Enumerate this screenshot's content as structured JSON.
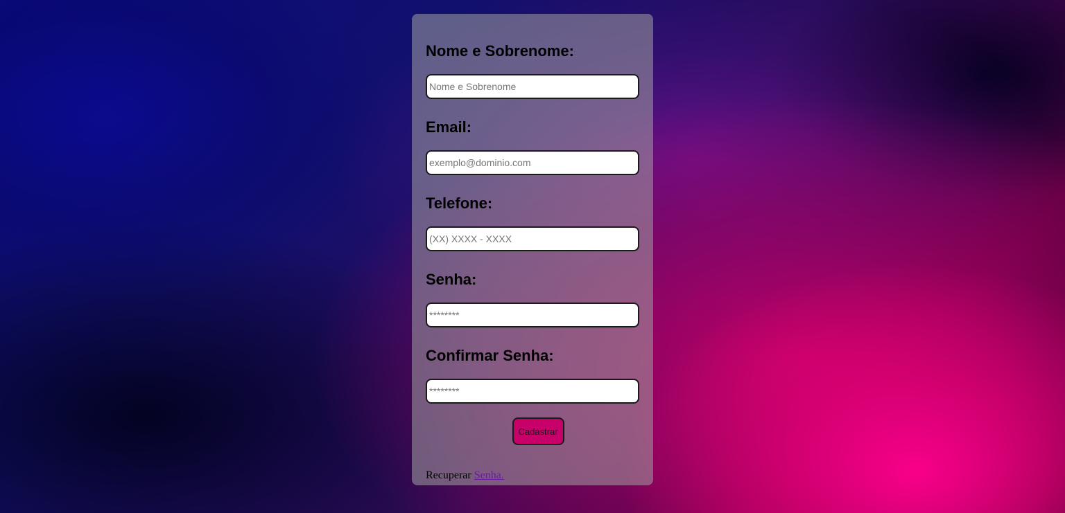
{
  "form": {
    "fields": [
      {
        "label": "Nome e Sobrenome:",
        "placeholder": "Nome e Sobrenome",
        "type": "text"
      },
      {
        "label": "Email:",
        "placeholder": "exemplo@dominio.com",
        "type": "email"
      },
      {
        "label": "Telefone:",
        "placeholder": "(XX) XXXX - XXXX",
        "type": "tel"
      },
      {
        "label": "Senha:",
        "placeholder": "********",
        "type": "password"
      },
      {
        "label": "Confirmar Senha:",
        "placeholder": "********",
        "type": "password"
      }
    ],
    "submit_label": "Cadastrar",
    "recover_text": "Recuperar",
    "recover_link": "Senha."
  },
  "colors": {
    "button": "#c8006a",
    "link": "#6a1aa0",
    "card_overlay": "rgba(160,160,160,0.55)"
  }
}
